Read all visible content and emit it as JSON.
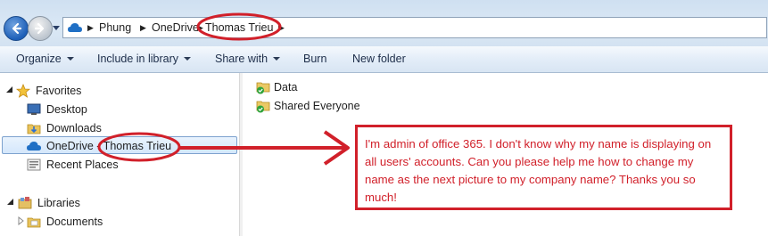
{
  "address_bar": {
    "crumbs": [
      "Phung",
      "OneDrive",
      "Thomas Trieu"
    ]
  },
  "toolbar": {
    "commands": [
      {
        "label": "Organize",
        "dropdown": true
      },
      {
        "label": "Include in library",
        "dropdown": true
      },
      {
        "label": "Share with",
        "dropdown": true
      },
      {
        "label": "Burn",
        "dropdown": false
      },
      {
        "label": "New folder",
        "dropdown": false
      }
    ]
  },
  "nav_pane": {
    "favorites": {
      "label": "Favorites",
      "icon": "star-icon"
    },
    "items": [
      {
        "label": "Desktop",
        "icon": "desktop-icon"
      },
      {
        "label": "Downloads",
        "icon": "downloads-folder-icon"
      },
      {
        "label": "OneDrive - Thomas Trieu",
        "icon": "onedrive-cloud-icon",
        "selected": true
      },
      {
        "label": "Recent Places",
        "icon": "recent-places-icon"
      }
    ],
    "libraries": {
      "label": "Libraries",
      "icon": "libraries-icon"
    },
    "library_items": [
      {
        "label": "Documents",
        "icon": "documents-icon"
      }
    ]
  },
  "content": {
    "items": [
      {
        "label": "Data",
        "icon": "synced-folder-icon"
      },
      {
        "label": "Shared Everyone",
        "icon": "synced-folder-icon"
      }
    ]
  },
  "annotation": {
    "text": "I'm admin of office 365. I don't know why my name is displaying on all users' accounts. Can you please help me how to change my name as the next picture to my company name? Thanks you so much!",
    "color": "#d1202a"
  },
  "colors": {
    "annotation_red": "#d1202a",
    "toolbar_bg": "#dfeaf6",
    "selection_border": "#7da2ce"
  }
}
